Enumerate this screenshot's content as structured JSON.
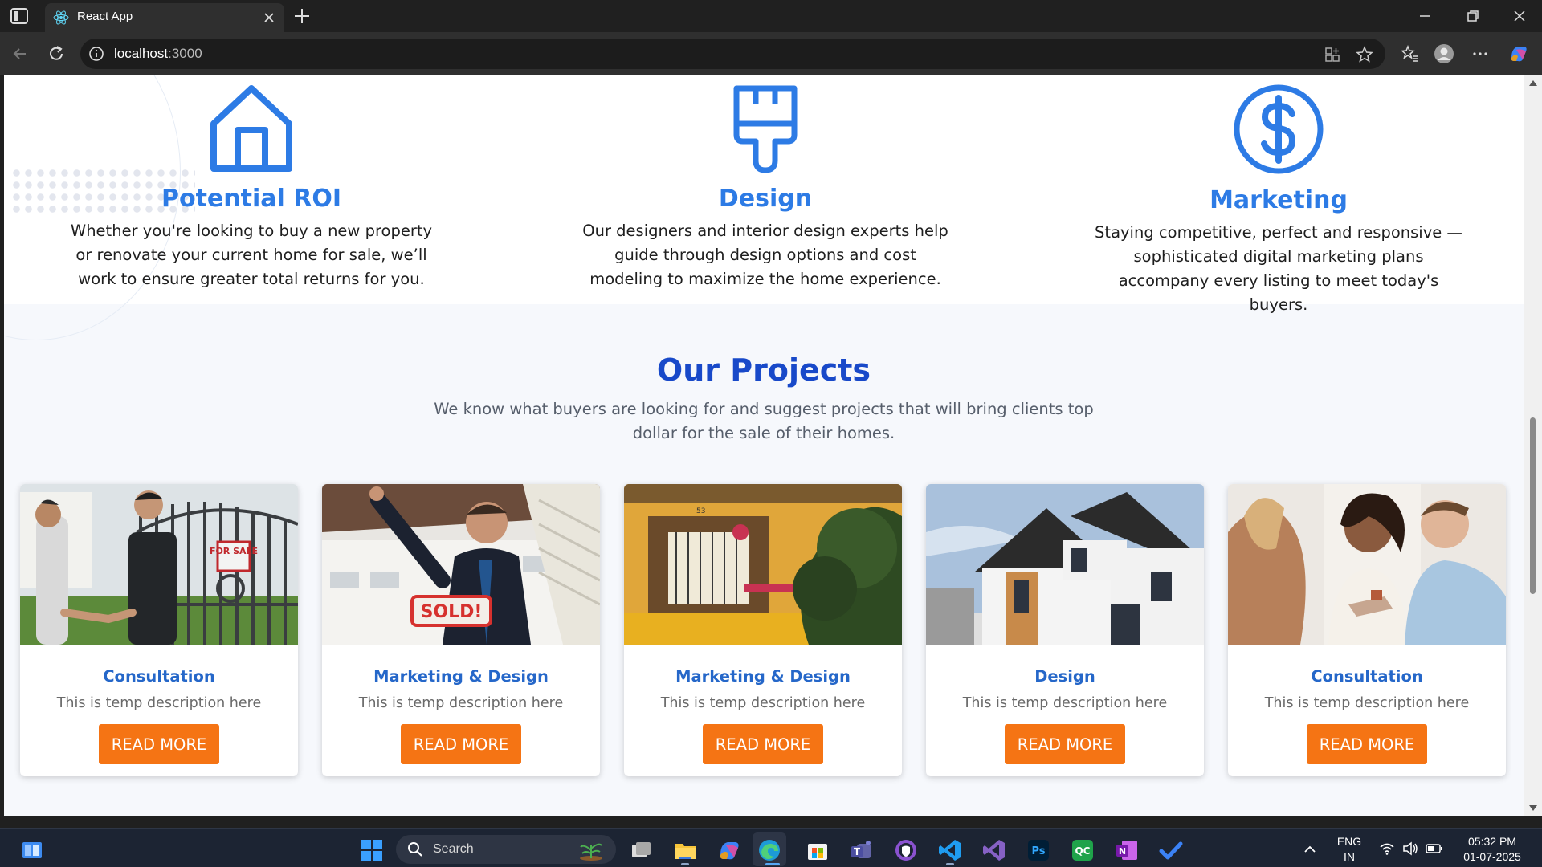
{
  "browser": {
    "tab_title": "React App",
    "url_host": "localhost",
    "url_rest": ":3000"
  },
  "services": [
    {
      "title": "Potential ROI",
      "description": "Whether you're looking to buy a new property or renovate your current home for sale, we’ll work to ensure greater total returns for you.",
      "icon": "house-icon"
    },
    {
      "title": "Design",
      "description": "Our designers and interior design experts help guide through design options and cost modeling to maximize the home experience.",
      "icon": "paintbrush-icon"
    },
    {
      "title": "Marketing",
      "description": "Staying competitive, perfect and responsive — sophisticated digital marketing plans accompany every listing to meet today's buyers.",
      "icon": "dollar-circle-icon"
    }
  ],
  "projects": {
    "title": "Our Projects",
    "subtitle": "We know what buyers are looking for and suggest projects that will bring clients top dollar for the sale of their homes.",
    "cards": [
      {
        "title": "Consultation",
        "description": "This is temp description here",
        "button": "READ MORE",
        "photo_sign": "FOR SALE"
      },
      {
        "title": "Marketing & Design",
        "description": "This is temp description here",
        "button": "READ MORE",
        "photo_sign": "SOLD!"
      },
      {
        "title": "Marketing & Design",
        "description": "This is temp description here",
        "button": "READ MORE",
        "photo_sign": "53"
      },
      {
        "title": "Design",
        "description": "This is temp description here",
        "button": "READ MORE"
      },
      {
        "title": "Consultation",
        "description": "This is temp description here",
        "button": "READ MORE"
      }
    ]
  },
  "taskbar": {
    "search_label": "Search",
    "lang_line1": "ENG",
    "lang_line2": "IN",
    "time": "05:32 PM",
    "date": "01-07-2025",
    "apps": [
      "start-icon",
      "task-view-icon",
      "file-explorer-icon",
      "copilot-icon",
      "edge-icon",
      "microsoft-store-icon",
      "teams-icon",
      "github-desktop-icon",
      "vscode-icon",
      "visual-studio-icon",
      "photoshop-icon",
      "qc-icon",
      "onenote-icon",
      "todo-icon"
    ]
  },
  "colors": {
    "accent_blue": "#2d7be5",
    "heading_blue": "#1849c9",
    "button_orange": "#f57414"
  }
}
